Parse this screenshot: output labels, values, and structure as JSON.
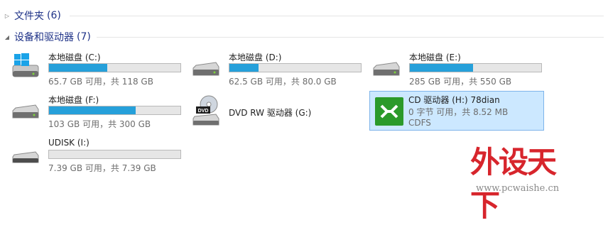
{
  "groups": {
    "folders": {
      "title": "文件夹",
      "count": "(6)",
      "expanded": false
    },
    "devices": {
      "title": "设备和驱动器",
      "count": "(7)",
      "expanded": true
    }
  },
  "drives": [
    {
      "name": "本地磁盘 (C:)",
      "free": "65.7 GB 可用，共 118 GB",
      "used_fraction": 0.443,
      "icon": "windows-system-drive-icon"
    },
    {
      "name": "本地磁盘 (D:)",
      "free": "62.5 GB 可用，共 80.0 GB",
      "used_fraction": 0.219,
      "icon": "hard-drive-icon"
    },
    {
      "name": "本地磁盘 (E:)",
      "free": "285 GB 可用，共 550 GB",
      "used_fraction": 0.482,
      "icon": "hard-drive-icon"
    },
    {
      "name": "本地磁盘 (F:)",
      "free": "103 GB 可用，共 300 GB",
      "used_fraction": 0.657,
      "icon": "hard-drive-icon"
    },
    {
      "name": "DVD RW 驱动器 (G:)",
      "icon": "dvd-drive-icon"
    },
    {
      "name": "UDISK (I:)",
      "free": "7.39 GB 可用，共 7.39 GB",
      "used_fraction": 0.0,
      "icon": "usb-drive-icon"
    }
  ],
  "cd_drive": {
    "name": "CD 驱动器 (H:) 78dian",
    "free": "0 字节 可用，共 8.52 MB",
    "fs": "CDFS",
    "selected": true,
    "icon": "cd-app-icon"
  },
  "watermark": {
    "logo_text": "外设天下",
    "url": "www.pcwaishe.cn"
  },
  "colors": {
    "bar_fill": "#26a0da",
    "selection_bg": "#cce8ff",
    "selection_border": "#7eb4ea",
    "header_text": "#1e3287",
    "watermark_red": "#d7252c"
  }
}
